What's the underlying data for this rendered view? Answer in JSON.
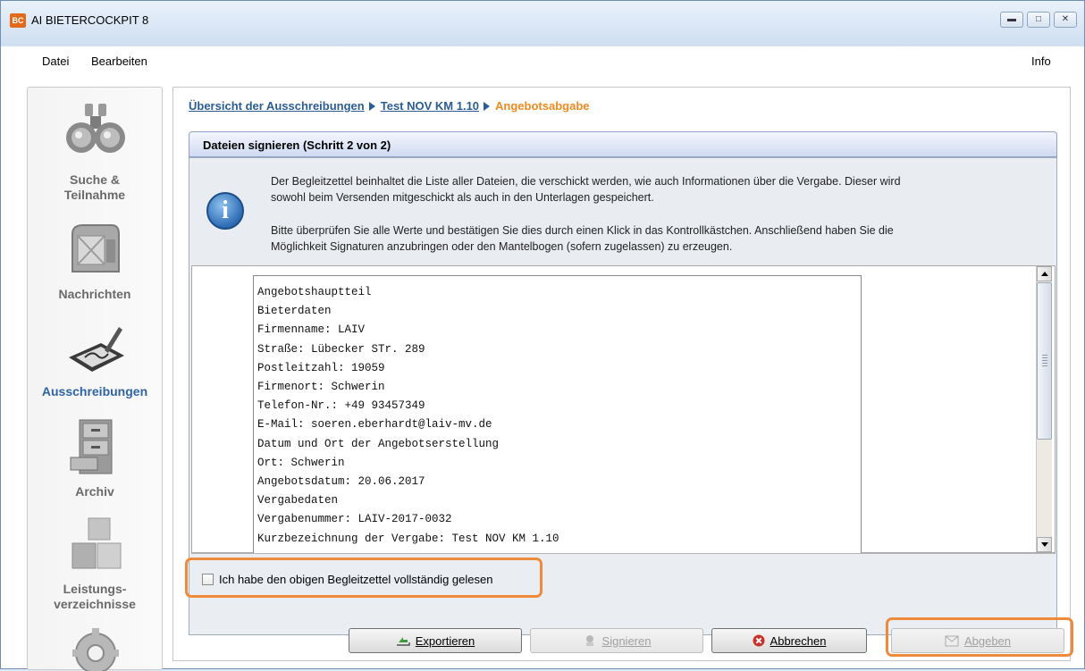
{
  "window": {
    "title": "AI BIETERCOCKPIT 8",
    "app_icon": "bc-app-icon",
    "controls": [
      "minimize",
      "maximize",
      "close"
    ]
  },
  "menu": {
    "items": [
      "Datei",
      "Bearbeiten"
    ],
    "right": "Info"
  },
  "sidebar": {
    "items": [
      {
        "label1": "Suche &",
        "label2": "Teilnahme",
        "icon": "binoculars-icon",
        "active": false
      },
      {
        "label1": "Nachrichten",
        "label2": "",
        "icon": "mailbox-icon",
        "active": false
      },
      {
        "label1": "Ausschreibungen",
        "label2": "",
        "icon": "signature-tablet-icon",
        "active": true
      },
      {
        "label1": "Archiv",
        "label2": "",
        "icon": "file-cabinet-icon",
        "active": false
      },
      {
        "label1": "Leistungs-",
        "label2": "verzeichnisse",
        "icon": "cubes-icon",
        "active": false
      }
    ]
  },
  "breadcrumb": {
    "items": [
      "Übersicht der Ausschreibungen",
      "Test NOV KM 1.10"
    ],
    "current": "Angebotsabgabe"
  },
  "step": {
    "title": "Dateien signieren (Schritt 2 von 2)"
  },
  "info": {
    "p1_l1": "Der Begleitzettel beinhaltet die Liste aller Dateien, die verschickt werden, wie auch Informationen über die Vergabe. Dieser wird",
    "p1_l2": "sowohl beim Versenden mitgeschickt als auch in den Unterlagen gespeichert.",
    "p2_l1": "Bitte überprüfen Sie alle Werte und bestätigen Sie dies durch einen Klick in das Kontrollkästchen. Anschließend haben Sie die",
    "p2_l2": "Möglichkeit Signaturen anzubringen oder den Mantelbogen (sofern zugelassen) zu erzeugen."
  },
  "document": {
    "lines": [
      "Angebotshauptteil",
      "Bieterdaten",
      "Firmenname: LAIV",
      "Straße: Lübecker STr. 289",
      "Postleitzahl: 19059",
      "Firmenort: Schwerin",
      "Telefon-Nr.: +49 93457349",
      "E-Mail: soeren.eberhardt@laiv-mv.de",
      "Datum und Ort der Angebotserstellung",
      "Ort: Schwerin",
      "Angebotsdatum: 20.06.2017",
      "Vergabedaten",
      "Vergabenummer: LAIV-2017-0032",
      "Kurzbezeichnung der Vergabe: Test NOV KM 1.10"
    ]
  },
  "confirm": {
    "label": "Ich habe den obigen Begleitzettel vollständig gelesen",
    "checked": false
  },
  "buttons": {
    "export": {
      "label": "Exportieren",
      "enabled": true
    },
    "sign": {
      "label": "Signieren",
      "enabled": false
    },
    "cancel": {
      "label": "Abbrechen",
      "enabled": true
    },
    "submit": {
      "label": "Abgeben",
      "enabled": false
    }
  },
  "colors": {
    "highlight": "#ee8a3c",
    "link": "#2b5c93",
    "current": "#ef8a1f",
    "active_nav": "#2e64a6"
  }
}
